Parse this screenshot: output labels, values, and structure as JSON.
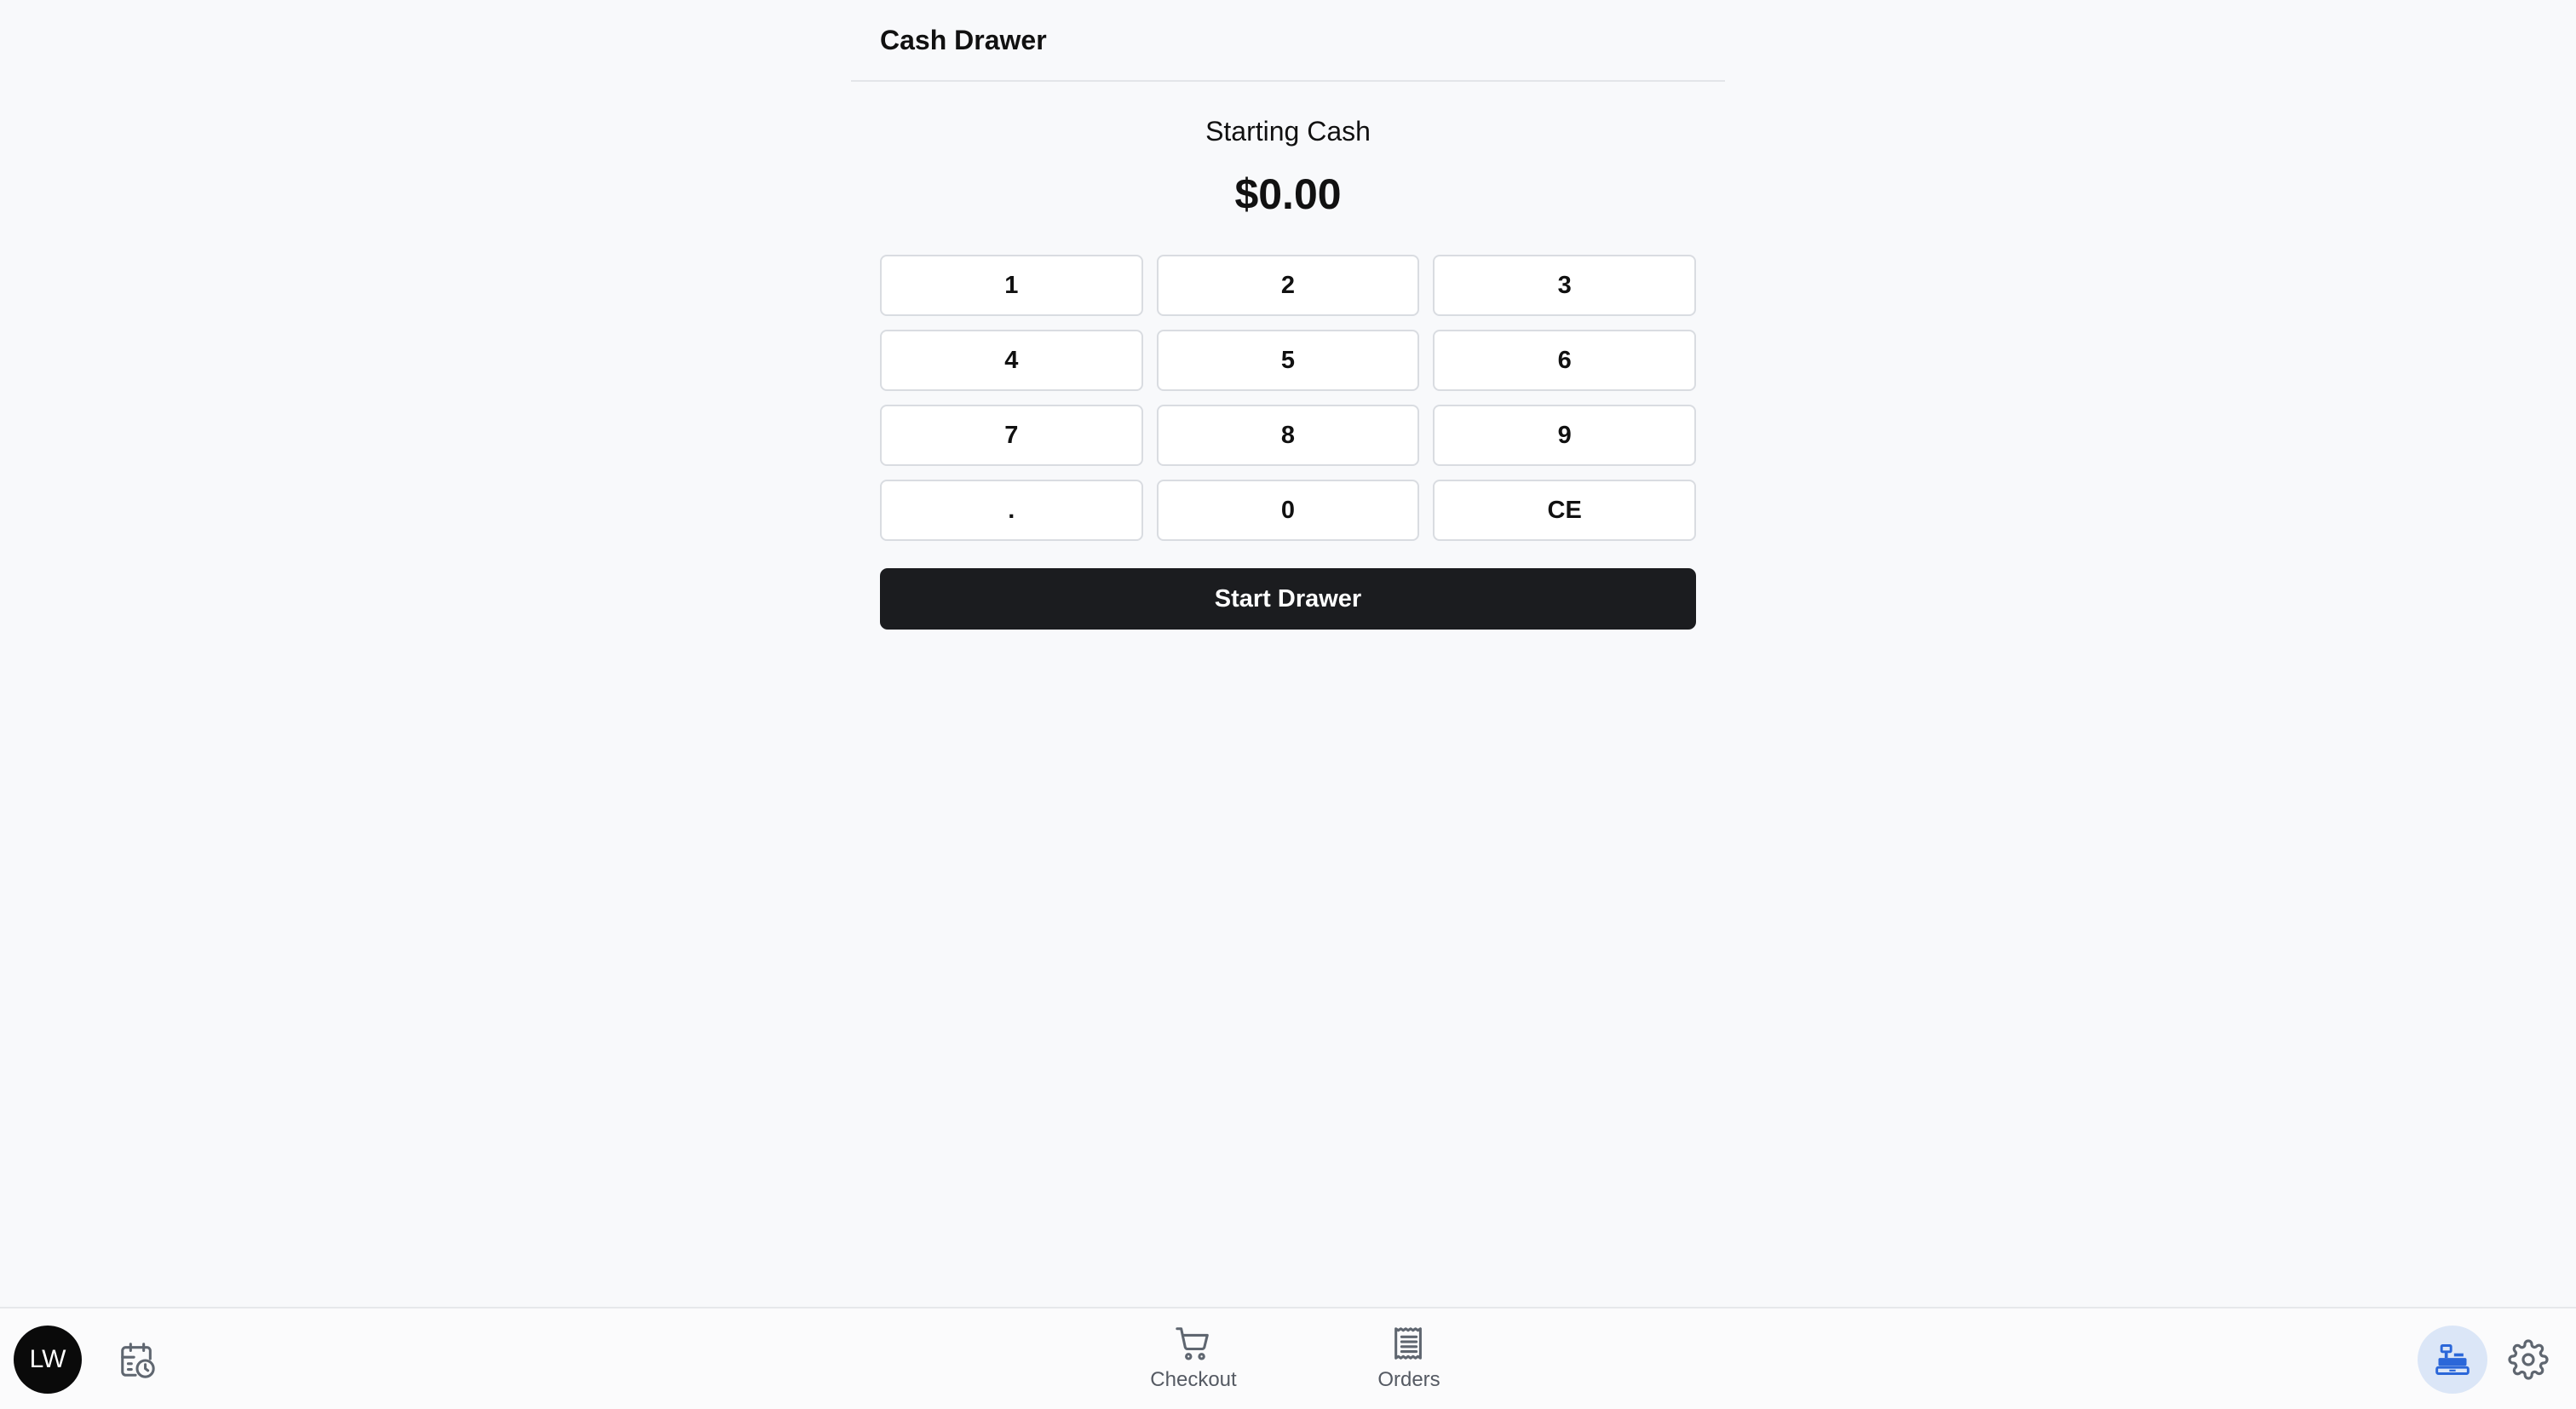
{
  "header": {
    "title": "Cash Drawer"
  },
  "starting": {
    "label": "Starting Cash",
    "amount": "$0.00"
  },
  "keypad": {
    "keys": [
      "1",
      "2",
      "3",
      "4",
      "5",
      "6",
      "7",
      "8",
      "9",
      ".",
      "0",
      "CE"
    ]
  },
  "actions": {
    "start_label": "Start Drawer"
  },
  "bottom_bar": {
    "avatar_initials": "LW",
    "nav": [
      {
        "label": "Checkout",
        "icon": "cart-icon"
      },
      {
        "label": "Orders",
        "icon": "receipt-icon"
      }
    ],
    "right_icons": [
      "cash-register-icon",
      "gear-icon"
    ],
    "left_icons": [
      "calendar-clock-icon"
    ]
  },
  "colors": {
    "background": "#f8f9fb",
    "primary_button": "#1b1c1f",
    "active_icon": "#2b67d9",
    "active_icon_bg": "#dbe6f7"
  }
}
